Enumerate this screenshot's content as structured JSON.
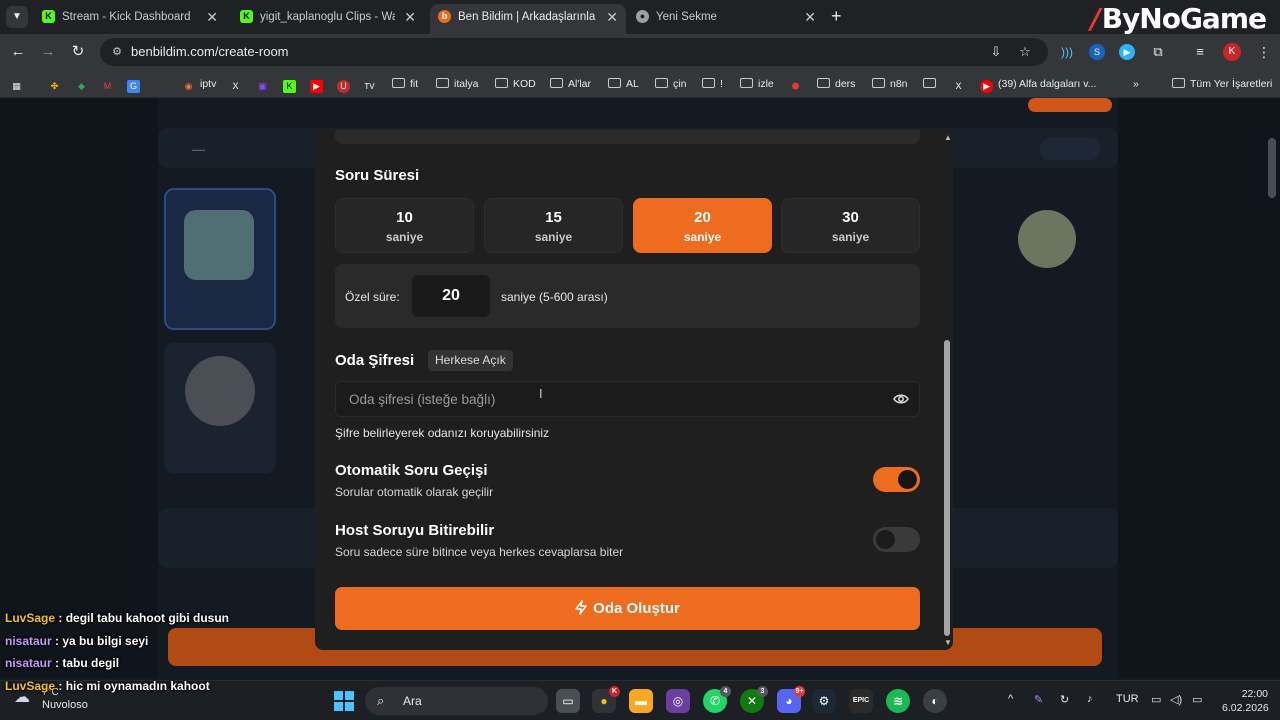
{
  "browser": {
    "tabs": [
      {
        "title": "Stream - Kick Dashboard",
        "active": false
      },
      {
        "title": "yigit_kaplanoglu Clips - Watch Live",
        "active": false
      },
      {
        "title": "Ben Bildim | Arkadaşlarınla Online Quiz",
        "active": true
      },
      {
        "title": "Yeni Sekme",
        "active": false
      }
    ],
    "url": "benbildim.com/create-room",
    "profile_initial": "K",
    "brand_overlay": "ByNoGame",
    "bookmarks": [
      "iptv",
      "fit",
      "italya",
      "KOD",
      "Al'lar",
      "AL",
      "çin",
      "!",
      "izle",
      "ders",
      "n8n",
      "(39) Alfa dalgaları v..."
    ],
    "all_bookmarks_label": "Tüm Yer İşaretleri"
  },
  "modal": {
    "duration_title": "Soru Süresi",
    "durations": [
      {
        "value": "10",
        "unit": "saniye",
        "selected": false
      },
      {
        "value": "15",
        "unit": "saniye",
        "selected": false
      },
      {
        "value": "20",
        "unit": "saniye",
        "selected": true
      },
      {
        "value": "30",
        "unit": "saniye",
        "selected": false
      }
    ],
    "custom": {
      "label": "Özel süre:",
      "value": "20",
      "hint": "saniye (5-600 arası)"
    },
    "password": {
      "title": "Oda Şifresi",
      "badge": "Herkese Açık",
      "placeholder": "Oda şifresi (isteğe bağlı)",
      "helper": "Şifre belirleyerek odanızı koruyabilirsiniz"
    },
    "auto_advance": {
      "title": "Otomatik Soru Geçişi",
      "desc": "Sorular otomatik olarak geçilir",
      "on": true
    },
    "host_end": {
      "title": "Host Soruyu Bitirebilir",
      "desc": "Soru sadece süre bitince veya herkes cevaplarsa biter",
      "on": false
    },
    "create_button": "Oda Oluştur"
  },
  "chat": [
    {
      "user": "LuvSage",
      "message": ": degil tabu kahoot gibi dusun"
    },
    {
      "user": "nisataur",
      "message": ": ya bu bilgi seyi"
    },
    {
      "user": "nisataur",
      "message": ": tabu degil"
    },
    {
      "user": "LuvSage",
      "message": ": hic mi oynamadın kahoot"
    }
  ],
  "taskbar": {
    "weather_temp": "7°C",
    "weather_condition": "Nuvoloso",
    "search_label": "Ara",
    "language": "TUR",
    "time": "22:00",
    "date": "6.02.2026",
    "whatsapp_badge": "4",
    "xbox_badge": "3",
    "discord_badge": "9+"
  },
  "colors": {
    "accent": "#ee6c20",
    "modal_bg": "#1f1f1f",
    "page_bg": "#10151c"
  }
}
